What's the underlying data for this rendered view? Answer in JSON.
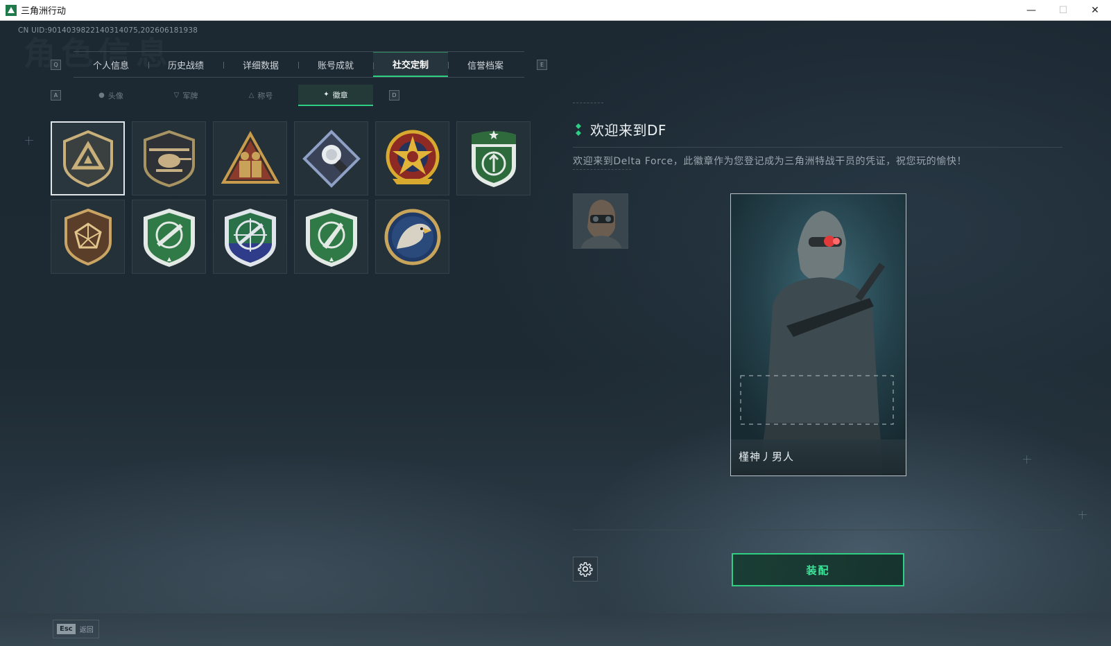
{
  "window": {
    "title": "三角洲行动",
    "controls": {
      "minimize": "—",
      "maximize": "☐",
      "close": "✕"
    }
  },
  "uid": "CN UID:9014039822140314075,202606181938",
  "background_title": "角色信息",
  "main_tabs": {
    "left_key": "Q",
    "right_key": "E",
    "items": [
      {
        "label": "个人信息",
        "active": false
      },
      {
        "label": "历史战绩",
        "active": false
      },
      {
        "label": "详细数据",
        "active": false
      },
      {
        "label": "账号成就",
        "active": false
      },
      {
        "label": "社交定制",
        "active": true
      },
      {
        "label": "信誉档案",
        "active": false
      }
    ]
  },
  "sub_tabs": {
    "left_key": "A",
    "right_key": "D",
    "items": [
      {
        "label": "头像",
        "icon": "person-icon",
        "active": false
      },
      {
        "label": "军牌",
        "icon": "dogtag-icon",
        "active": false
      },
      {
        "label": "称号",
        "icon": "title-icon",
        "active": false
      },
      {
        "label": "徽章",
        "icon": "badge-icon",
        "active": true
      }
    ]
  },
  "badges": [
    {
      "name": "delta-shield-badge",
      "selected": true
    },
    {
      "name": "helicopter-badge",
      "selected": false
    },
    {
      "name": "soldiers-triangle-badge",
      "selected": false
    },
    {
      "name": "rose-diamond-badge",
      "selected": false
    },
    {
      "name": "gold-star-badge",
      "selected": false
    },
    {
      "name": "green-shield-badge",
      "selected": false
    },
    {
      "name": "brown-dice-badge",
      "selected": false
    },
    {
      "name": "green-rifle-badge",
      "selected": false
    },
    {
      "name": "blue-sniper-badge",
      "selected": false
    },
    {
      "name": "green-knife-badge",
      "selected": false
    },
    {
      "name": "eagle-badge",
      "selected": false
    }
  ],
  "detail": {
    "title": "欢迎来到DF",
    "description": "欢迎来到Delta Force，此徽章作为您登记成为三角洲特战干员的凭证，祝您玩的愉快！",
    "operator_name": "槿神丿男人",
    "equip_label": "装配",
    "settings_icon": "gear-icon"
  },
  "footer": {
    "esc_key": "Esc",
    "esc_label": "返回"
  },
  "colors": {
    "accent": "#2fcf83",
    "background": "#1d2a33"
  }
}
